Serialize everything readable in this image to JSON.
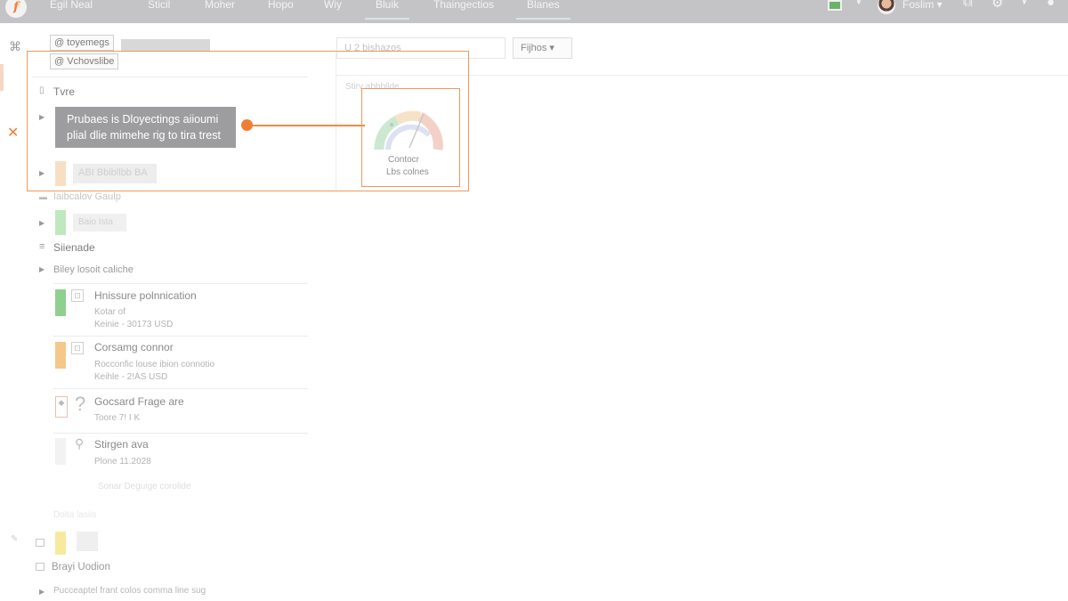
{
  "topbar": {
    "logo": "f",
    "nav": [
      "Egil Neal",
      "Sticil",
      "Moher",
      "Hopo",
      "Wiy",
      "Bluik",
      "Thaingectios",
      "Blanes"
    ],
    "active_nav": "Bluik",
    "user_name": "Foslim ▾",
    "icons": [
      "chart-icon",
      "avatar-icon",
      "share-icon",
      "settings-icon",
      "chevron-down-icon",
      "question-icon"
    ]
  },
  "toolbar": {
    "tag_one": "@ toyemegs",
    "tag_two": "@ Vchovslibe",
    "search_value": "U 2 bishazos",
    "filter_label": "Fijhos ▾"
  },
  "tree": {
    "section_label": "Tvre",
    "tooltip_line1": "Prubaes is Dloyectings aiioumi",
    "tooltip_line2": "plial dlie mimehe rig to tira trest",
    "row_blurred": "ABI Bbibllbb BA",
    "row_two": "Iaibcalov Gaulp",
    "row_three": "Baio Ista",
    "section_two": "Siienade",
    "row_four": "Biley losoit caliche"
  },
  "right_panel": {
    "header": "Stirv abbbllde",
    "gauge_label1": "Contocr",
    "gauge_label2": "Lbs colnes"
  },
  "list": [
    {
      "title": "Hnissure polnnication",
      "sub1": "Kotar of",
      "sub2": "Keinie - 30173 USD",
      "color": "#8fd08f"
    },
    {
      "title": "Corsamg connor",
      "sub1": "Rocconfic louse ibion connotio",
      "sub2": "Keihle - 2!AS USD",
      "color": "#f4c88a"
    },
    {
      "title": "Gocsard Frage are",
      "sub1": "Toore 7! I K",
      "sub2": "",
      "color": "#ffffff"
    },
    {
      "title": "Stirgen ava",
      "sub1": "Plone 11.2028",
      "sub2": "",
      "color": "#f2f2f2"
    }
  ],
  "footer_rows": {
    "ghost": "Sonar Deguige corolide",
    "ghost_two": "Dolta lasiis",
    "bottom_title": "Brayi Uodion",
    "bottom_sub": "Pucceaptel frant colos comma line sug"
  },
  "colors": {
    "accent": "#ef7e35",
    "topbar": "#c4c4c6",
    "tooltip": "#9d9d9f"
  }
}
